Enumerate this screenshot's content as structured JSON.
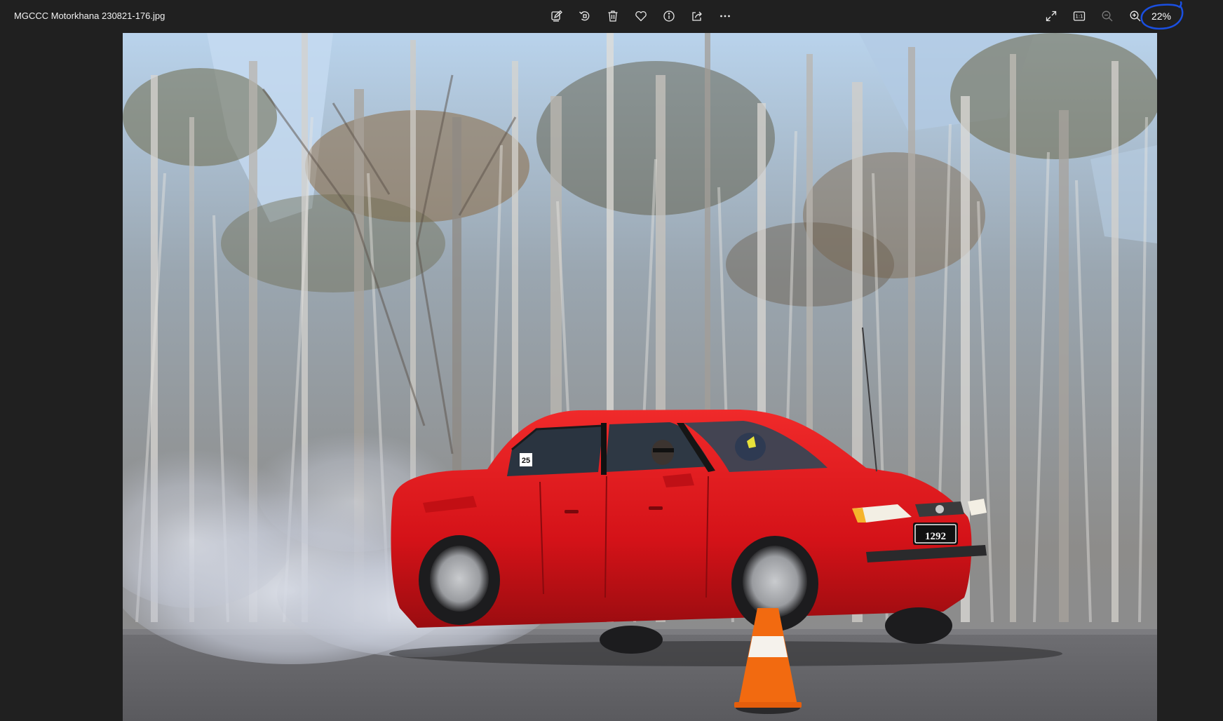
{
  "window": {
    "file_name": "MGCCC Motorkhana 230821-176.jpg"
  },
  "toolbar": {
    "actions": [
      {
        "name": "edit-icon",
        "label": "Edit image"
      },
      {
        "name": "rotate-icon",
        "label": "Rotate"
      },
      {
        "name": "delete-icon",
        "label": "Delete"
      },
      {
        "name": "heart-icon",
        "label": "Favorite"
      },
      {
        "name": "info-icon",
        "label": "File info"
      },
      {
        "name": "share-icon",
        "label": "Share"
      },
      {
        "name": "more-icon",
        "label": "See more"
      }
    ],
    "view_actions": [
      {
        "name": "fullscreen-icon",
        "label": "Full screen"
      },
      {
        "name": "actual-size-icon",
        "label": "Actual size"
      },
      {
        "name": "zoom-out-icon",
        "label": "Zoom out"
      },
      {
        "name": "zoom-in-icon",
        "label": "Zoom in"
      }
    ],
    "zoom_percent": "22%",
    "zoom_value": 22,
    "actual_size_glyph": "1:1"
  },
  "photo": {
    "number_card": "25",
    "plate_text": "1292"
  },
  "colors": {
    "background": "#202020",
    "annotation": "#1a4fe0",
    "car": "#e01419",
    "cone": "#f26a10"
  }
}
